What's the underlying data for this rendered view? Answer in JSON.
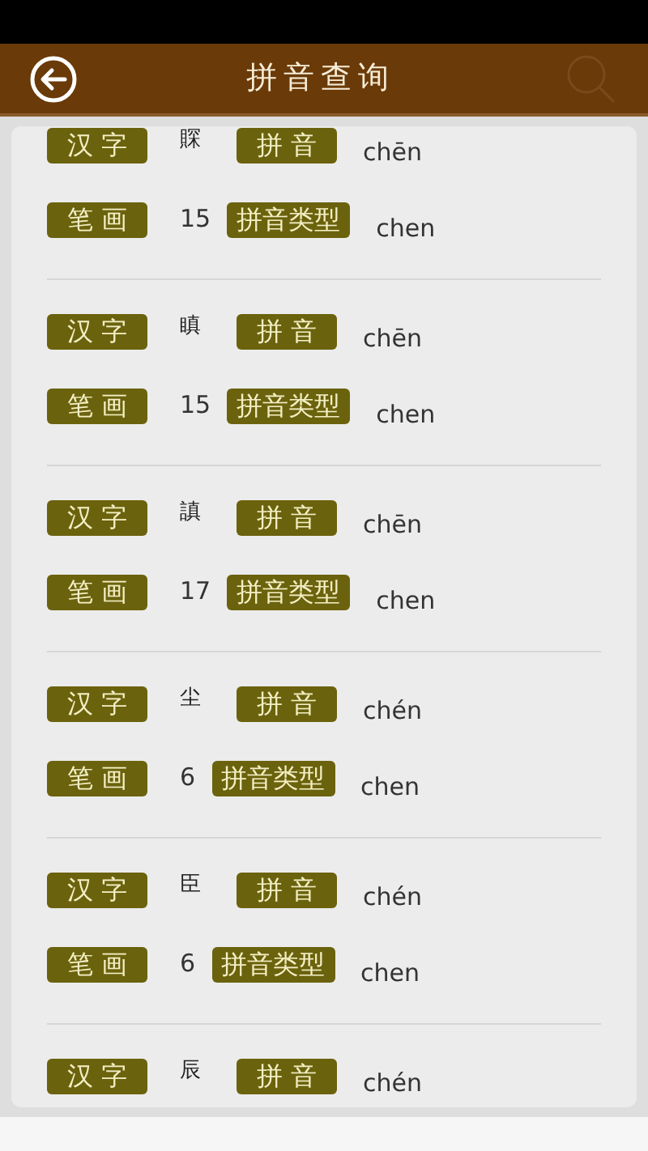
{
  "header": {
    "title": "拼音查询"
  },
  "entries": [
    {
      "char_label": "汉 字",
      "character": "賝",
      "pinyin_label": "拼 音",
      "pinyin": "chēn",
      "strokes_label": "笔 画",
      "strokes": "15",
      "type_label": "拼音类型",
      "pinyin_type": "chen"
    },
    {
      "char_label": "汉 字",
      "character": "瞋",
      "pinyin_label": "拼 音",
      "pinyin": "chēn",
      "strokes_label": "笔 画",
      "strokes": "15",
      "type_label": "拼音类型",
      "pinyin_type": "chen"
    },
    {
      "char_label": "汉 字",
      "character": "謓",
      "pinyin_label": "拼 音",
      "pinyin": "chēn",
      "strokes_label": "笔 画",
      "strokes": "17",
      "type_label": "拼音类型",
      "pinyin_type": "chen"
    },
    {
      "char_label": "汉 字",
      "character": "尘",
      "pinyin_label": "拼 音",
      "pinyin": "chén",
      "strokes_label": "笔 画",
      "strokes": "6",
      "type_label": "拼音类型",
      "pinyin_type": "chen"
    },
    {
      "char_label": "汉 字",
      "character": "臣",
      "pinyin_label": "拼 音",
      "pinyin": "chén",
      "strokes_label": "笔 画",
      "strokes": "6",
      "type_label": "拼音类型",
      "pinyin_type": "chen"
    },
    {
      "char_label": "汉 字",
      "character": "辰",
      "pinyin_label": "拼 音",
      "pinyin": "chén"
    }
  ]
}
